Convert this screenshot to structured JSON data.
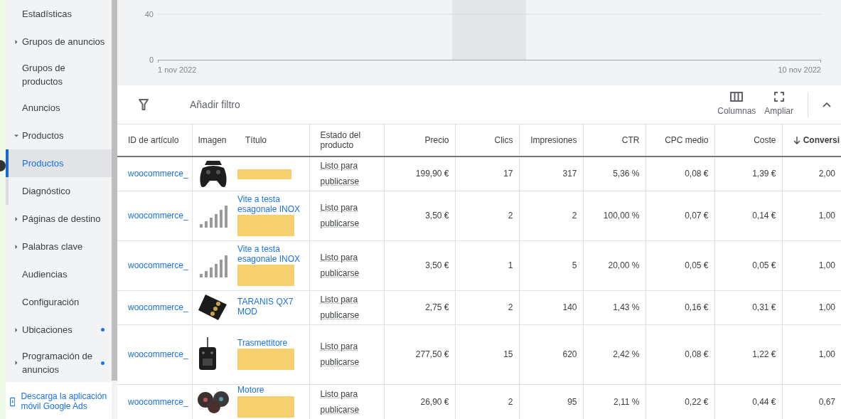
{
  "sidebar": {
    "items": [
      {
        "label": "Estadísticas",
        "kind": "link",
        "selected": false,
        "dot": false
      },
      {
        "label": "Grupos de anuncios",
        "kind": "group",
        "expanded": false,
        "selected": false,
        "dot": false
      },
      {
        "label": "Grupos de productos",
        "kind": "link",
        "selected": false,
        "dot": false
      },
      {
        "label": "Anuncios",
        "kind": "link",
        "selected": false,
        "dot": false
      },
      {
        "label": "Productos",
        "kind": "group",
        "expanded": true,
        "selected": false,
        "dot": false,
        "children": [
          {
            "label": "Productos",
            "kind": "link",
            "selected": true,
            "dot": false
          },
          {
            "label": "Diagnóstico",
            "kind": "link",
            "selected": false,
            "dot": false
          }
        ]
      },
      {
        "label": "Páginas de destino",
        "kind": "group",
        "expanded": false,
        "selected": false,
        "dot": false
      },
      {
        "label": "Palabras clave",
        "kind": "group",
        "expanded": false,
        "selected": false,
        "dot": false
      },
      {
        "label": "Audiencias",
        "kind": "link",
        "selected": false,
        "dot": false
      },
      {
        "label": "Configuración",
        "kind": "link",
        "selected": false,
        "dot": false
      },
      {
        "label": "Ubicaciones",
        "kind": "group",
        "expanded": false,
        "selected": false,
        "dot": true
      },
      {
        "label": "Programación de anuncios",
        "kind": "group",
        "expanded": false,
        "selected": false,
        "dot": true
      }
    ],
    "download_link": "Descarga la aplicación móvil Google Ads"
  },
  "chart": {
    "y_ticks": [
      "40",
      "0"
    ],
    "x_labels": [
      "1 nov 2022",
      "10 nov 2022"
    ]
  },
  "toolbar": {
    "filter_label": "Añadir filtro",
    "buttons": [
      {
        "label": "Columnas",
        "kind": "columns"
      },
      {
        "label": "Ampliar",
        "kind": "expand"
      }
    ]
  },
  "table": {
    "columns": [
      {
        "label": "ID de artículo",
        "kind": "text",
        "sorted": false
      },
      {
        "label": "Imagen",
        "kind": "text",
        "sorted": false
      },
      {
        "label": "Título",
        "kind": "text",
        "sorted": false
      },
      {
        "label": "Estado del producto",
        "kind": "text",
        "sorted": false
      },
      {
        "label": "Precio",
        "kind": "number",
        "sorted": false
      },
      {
        "label": "Clics",
        "kind": "number",
        "sorted": false
      },
      {
        "label": "Impresiones",
        "kind": "number",
        "sorted": false
      },
      {
        "label": "CTR",
        "kind": "number",
        "sorted": false
      },
      {
        "label": "CPC medio",
        "kind": "number",
        "sorted": false
      },
      {
        "label": "Coste",
        "kind": "number",
        "sorted": false
      },
      {
        "label": "Conversi",
        "kind": "number",
        "sorted": true
      }
    ],
    "rows": [
      {
        "kind": "gamepad",
        "title_redacted": true,
        "cells": [
          "woocommerce_",
          "",
          "",
          "Listo para publicarse",
          "199,90 €",
          "17",
          "317",
          "5,36 %",
          "0,08 €",
          "1,39 €",
          "2,00"
        ]
      },
      {
        "kind": "screws",
        "title_redacted": true,
        "cells": [
          "woocommerce_",
          "",
          "Vite a testa esagonale INOX",
          "Listo para publicarse",
          "3,50 €",
          "2",
          "2",
          "100,00 %",
          "0,07 €",
          "0,14 €",
          "1,00"
        ]
      },
      {
        "kind": "screws",
        "title_redacted": true,
        "cells": [
          "woocommerce_",
          "",
          "Vite a testa esagonale INOX",
          "Listo para publicarse",
          "3,50 €",
          "1",
          "5",
          "20,00 %",
          "0,05 €",
          "0,05 €",
          "1,00"
        ]
      },
      {
        "kind": "board",
        "title_redacted": false,
        "cells": [
          "woocommerce_",
          "",
          "TARANIS QX7 MOD",
          "Listo para publicarse",
          "2,75 €",
          "2",
          "140",
          "1,43 %",
          "0,16 €",
          "0,31 €",
          "1,00"
        ]
      },
      {
        "kind": "transmitter",
        "title_redacted": true,
        "cells": [
          "woocommerce_",
          "",
          "Trasmettitore",
          "Listo para publicarse",
          "277,50 €",
          "15",
          "620",
          "2,42 %",
          "0,08 €",
          "1,22 €",
          "1,00"
        ]
      },
      {
        "kind": "motors",
        "title_redacted": true,
        "cells": [
          "woocommerce_",
          "",
          "Motore",
          "Listo para publicarse",
          "26,90 €",
          "2",
          "95",
          "2,11 %",
          "0,22 €",
          "0,44 €",
          "0,67"
        ]
      }
    ]
  }
}
